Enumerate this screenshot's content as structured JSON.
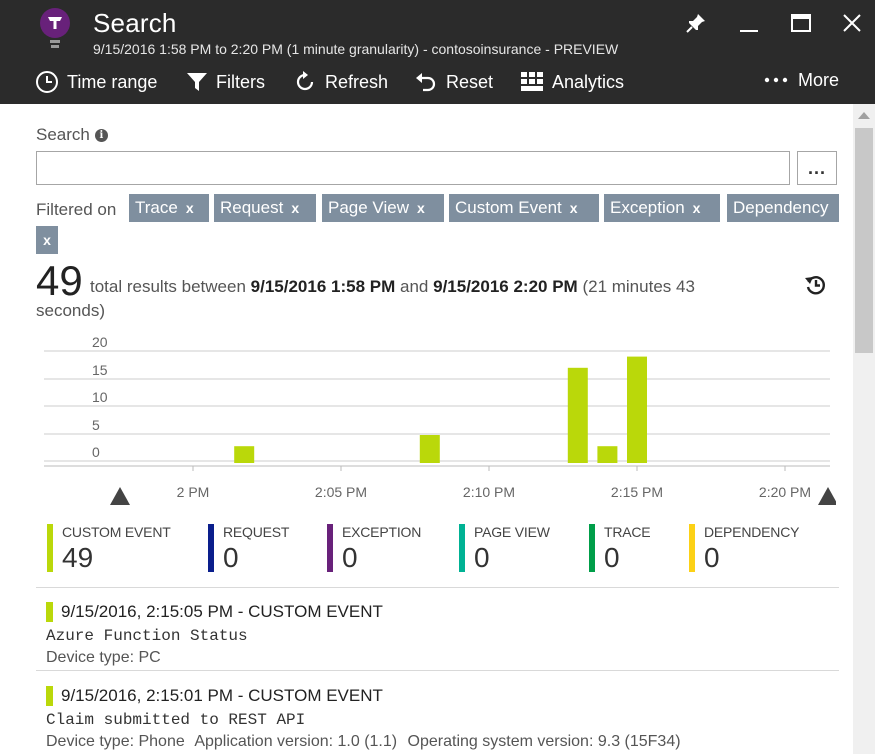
{
  "header": {
    "title": "Search",
    "subtitle": "9/15/2016 1:58 PM to 2:20 PM (1 minute granularity) - contosoinsurance - PREVIEW"
  },
  "toolbar": {
    "time_range": "Time range",
    "filters": "Filters",
    "refresh": "Refresh",
    "reset": "Reset",
    "analytics": "Analytics",
    "more": "More"
  },
  "search": {
    "label": "Search",
    "value": "",
    "more_button": "..."
  },
  "filters": {
    "label": "Filtered on",
    "chips": [
      "Trace",
      "Request",
      "Page View",
      "Custom Event",
      "Exception",
      "Dependency"
    ],
    "remove_glyph": "x"
  },
  "summary": {
    "count": "49",
    "text_before": "total results between",
    "start": "9/15/2016 1:58 PM",
    "text_and": "and",
    "end": "9/15/2016 2:20 PM",
    "duration_part1": "(21 minutes 43",
    "duration_part2": "seconds)"
  },
  "chart_data": {
    "type": "bar",
    "x_ticks": [
      "2 PM",
      "2:05 PM",
      "2:10 PM",
      "2:15 PM",
      "2:20 PM"
    ],
    "y_ticks": [
      "0",
      "5",
      "10",
      "15",
      "20"
    ],
    "ylim": [
      0,
      20
    ],
    "grid": true,
    "categories": [
      "2:02 PM",
      "2:08 PM",
      "2:13 PM",
      "2:14 PM",
      "2:15 PM"
    ],
    "values": [
      3,
      5,
      17,
      3,
      19
    ],
    "color": "#bad80a"
  },
  "legend": [
    {
      "label": "CUSTOM EVENT",
      "value": "49",
      "color": "#bad80a"
    },
    {
      "label": "REQUEST",
      "value": "0",
      "color": "#0a1e8c"
    },
    {
      "label": "EXCEPTION",
      "value": "0",
      "color": "#68217a"
    },
    {
      "label": "PAGE VIEW",
      "value": "0",
      "color": "#00b294"
    },
    {
      "label": "TRACE",
      "value": "0",
      "color": "#009e49"
    },
    {
      "label": "DEPENDENCY",
      "value": "0",
      "color": "#fcd116"
    }
  ],
  "events": [
    {
      "title": "9/15/2016, 2:15:05 PM - CUSTOM EVENT",
      "message": "Azure Function Status",
      "props": [
        "Device type: PC"
      ]
    },
    {
      "title": "9/15/2016, 2:15:01 PM - CUSTOM EVENT",
      "message": "Claim submitted to REST API",
      "props": [
        "Device type: Phone",
        "Application version: 1.0 (1.1)",
        "Operating system version: 9.3 (15F34)"
      ]
    }
  ]
}
